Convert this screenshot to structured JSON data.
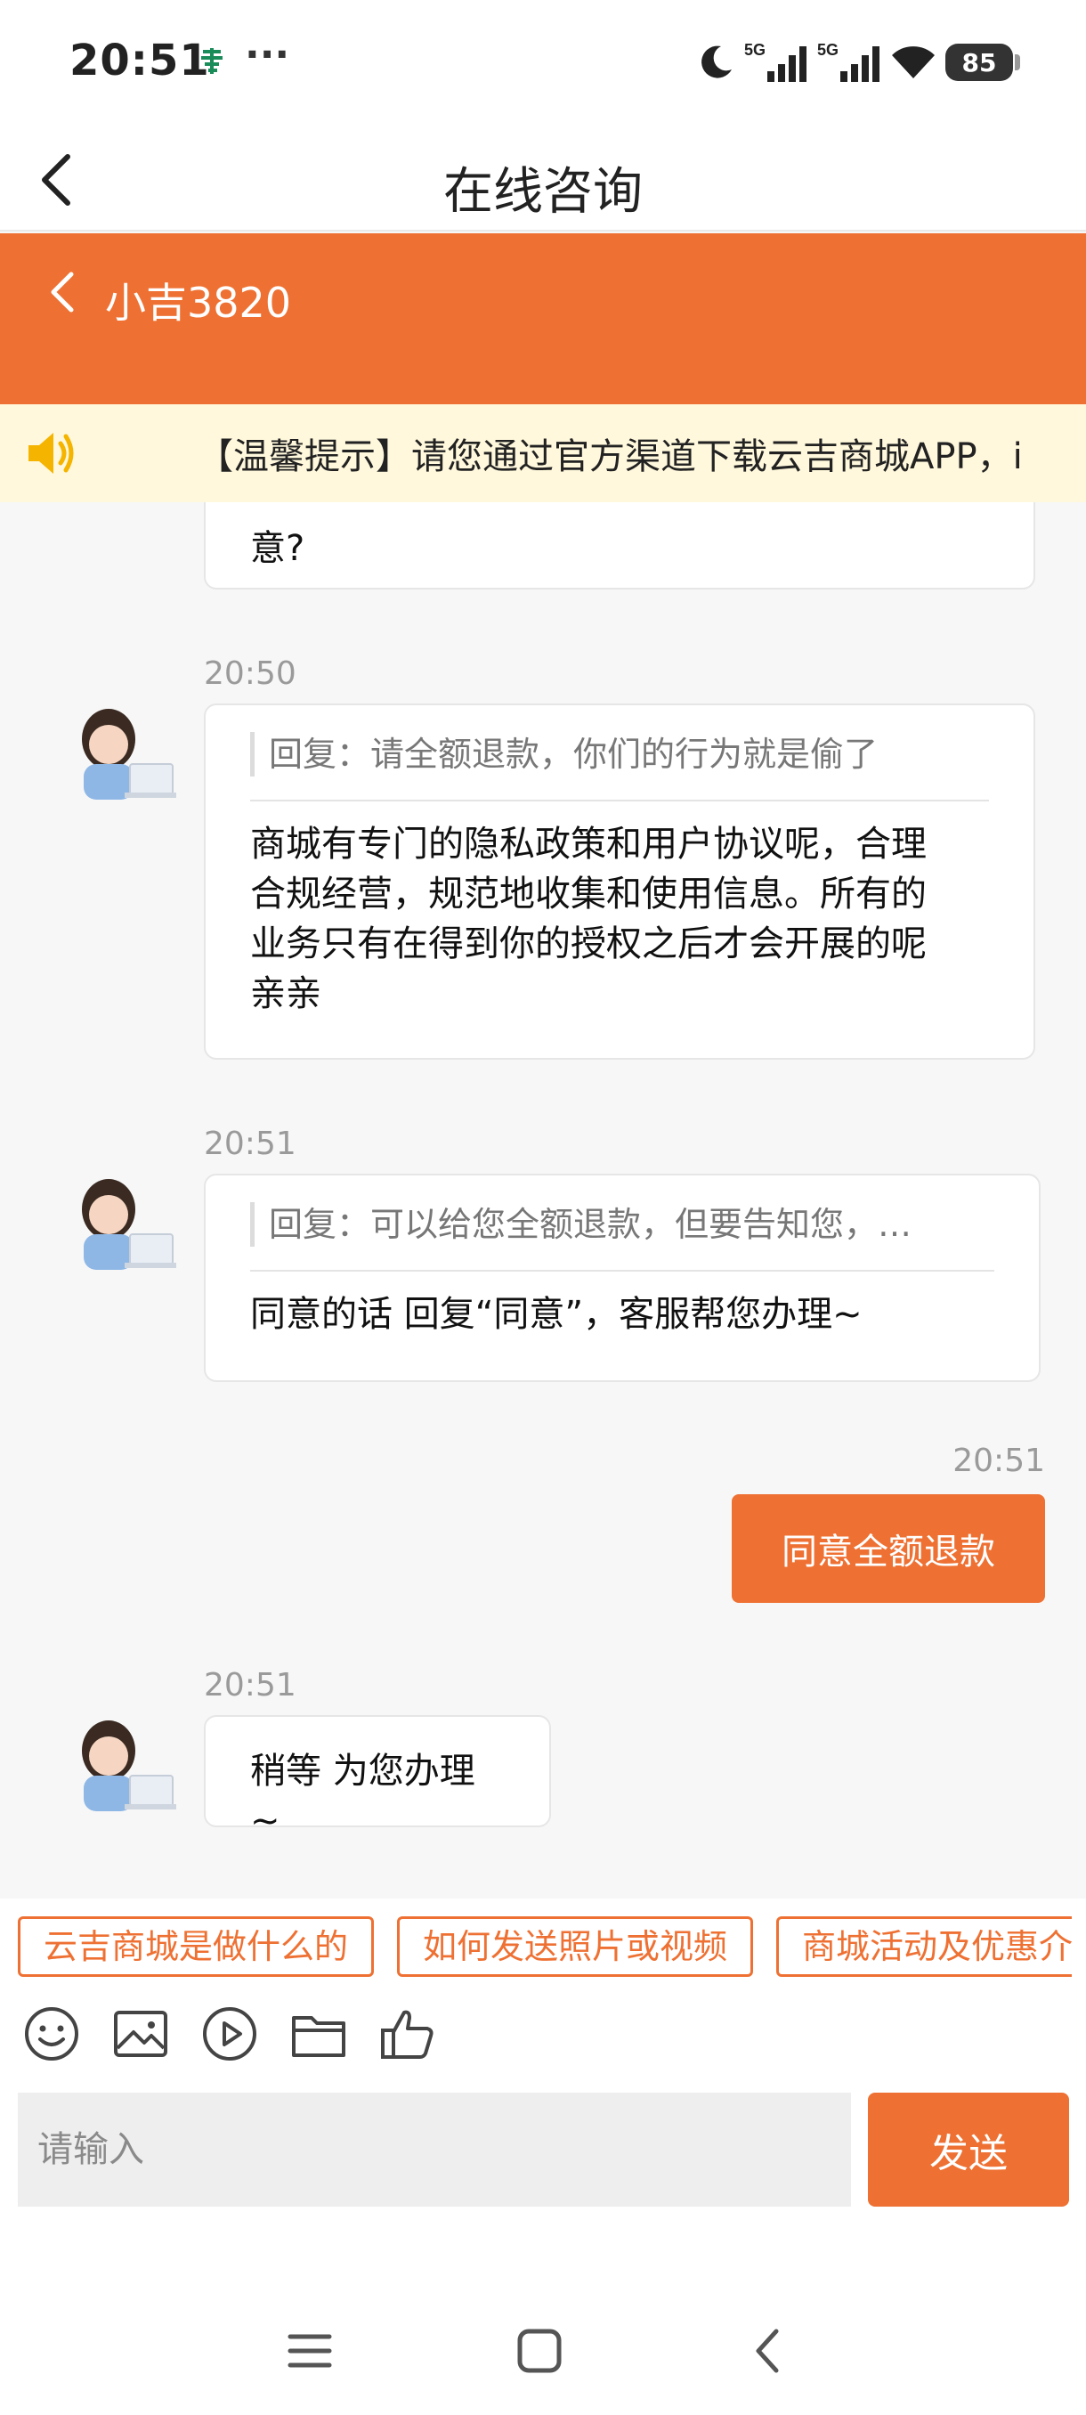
{
  "status_bar": {
    "time": "20:51",
    "dots": "···",
    "network_1": "5G",
    "network_2": "5G",
    "battery": "85"
  },
  "title_bar": {
    "title": "在线咨询"
  },
  "header": {
    "agent_name": "小吉3820",
    "color": "#ee7133"
  },
  "notice": {
    "text": "【温馨提示】请您通过官方渠道下载云吉商城APP，i"
  },
  "messages": [
    {
      "type": "agent_partial",
      "text": "意?"
    },
    {
      "type": "agent",
      "time": "20:50",
      "quote": "回复：请全额退款，你们的行为就是偷了",
      "lines": [
        "商城有专门的隐私政策和用户协议呢，合理",
        "合规经营，规范地收集和使用信息。所有的",
        "业务只有在得到你的授权之后才会开展的呢",
        "亲亲"
      ]
    },
    {
      "type": "agent",
      "time": "20:51",
      "quote": "回复：可以给您全额退款，但要告知您，…",
      "lines": [
        "同意的话 回复“同意”，客服帮您办理~"
      ]
    },
    {
      "type": "user",
      "time": "20:51",
      "text": "同意全额退款"
    },
    {
      "type": "agent",
      "time": "20:51",
      "text": "稍等 为您办理~"
    }
  ],
  "quick_replies": [
    "云吉商城是做什么的",
    "如何发送照片或视频",
    "商城活动及优惠介"
  ],
  "tool_icons": [
    "emoji-icon",
    "image-icon",
    "video-icon",
    "folder-icon",
    "thumbs-up-icon"
  ],
  "input": {
    "placeholder": "请输入",
    "send_label": "发送"
  }
}
